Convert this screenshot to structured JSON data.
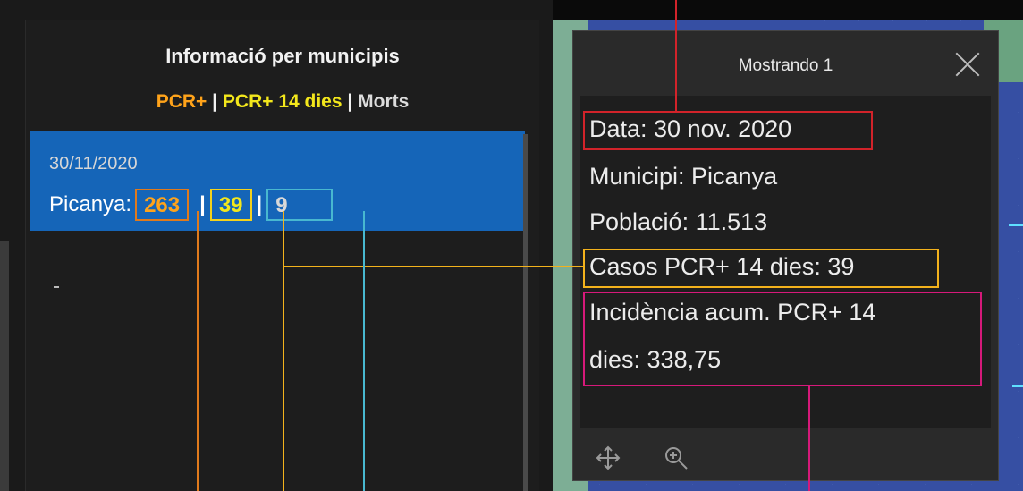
{
  "left_panel": {
    "title": "Informació per municipis",
    "legend": {
      "pcr": "PCR+",
      "pcr14": "PCR+ 14 dies",
      "sep": "|",
      "morts": "Morts"
    },
    "row": {
      "date": "30/11/2020",
      "municipality_label": "Picanya:",
      "pcr_value": "263",
      "pcr14_value": "39",
      "morts_value": "9",
      "separator": "|"
    }
  },
  "popup": {
    "title": "Mostrando 1",
    "fields": {
      "data": "Data: 30 nov. 2020",
      "municipi": "Municipi: Picanya",
      "poblacio": "Població: 11.513",
      "casos": "Casos PCR+ 14 dies: 39",
      "incidencia_1": "Incidència acum. PCR+ 14",
      "incidencia_2": "dies: 338,75"
    },
    "footer_icons": [
      "move-icon",
      "zoom-to-icon"
    ]
  },
  "colors": {
    "row_selected": "#1565b8",
    "pcr": "#ffa31a",
    "pcr14": "#f3e71c",
    "morts_box": "#48b8d0",
    "highlight_date": "#d2232a",
    "highlight_casos": "#f3b21c",
    "highlight_incidencia": "#d6197a",
    "map": "#364fa3"
  }
}
